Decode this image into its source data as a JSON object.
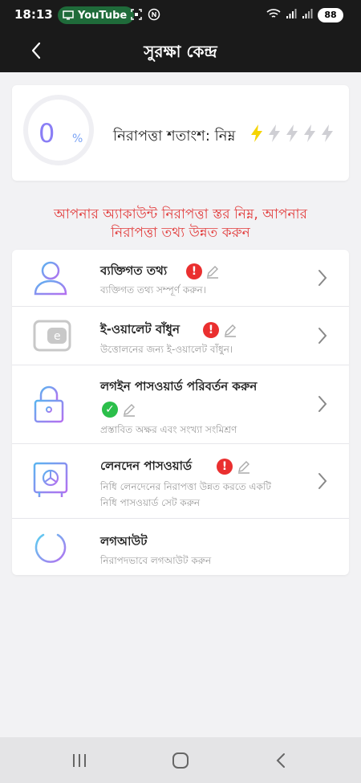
{
  "status_bar": {
    "time": "18:13",
    "app_pill": "YouTube",
    "battery": "88"
  },
  "header": {
    "title": "সুরক্ষা কেন্দ্র"
  },
  "score": {
    "value": "0",
    "unit": "%",
    "label": "নিরাপত্তা শতাংশ: নিম্ন",
    "bolts_total": 5,
    "bolts_active": 1
  },
  "warning": {
    "line1": "আপনার অ্যাকাউন্ট নিরাপত্তা স্তর নিম্ন, আপনার",
    "line2": "নিরাপত্তা তথ্য উন্নত করুন"
  },
  "menu": {
    "items": [
      {
        "title": "ব্যক্তিগত তথ্য",
        "sub1": "ব্যক্তিগত তথ্য সম্পূর্ণ করুন।",
        "sub2": "",
        "status": "warning"
      },
      {
        "title": "ই-ওয়ালেট বাঁধুন",
        "sub1": "উত্তোলনের জন্য ই-ওয়ালেট বাঁধুন।",
        "sub2": "",
        "status": "warning"
      },
      {
        "title": "লগইন পাসওয়ার্ড পরিবর্তন করুন",
        "sub1": "প্রস্তাবিত অক্ষর এবং সংখ্যা সংমিশ্রণ",
        "sub2": "",
        "status": "ok"
      },
      {
        "title": "লেনদেন পাসওয়ার্ড",
        "sub1": "নিধি লেনদেনের নিরাপত্তা উন্নত করতে একটি",
        "sub2": "নিধি পাসওয়ার্ড সেট করুন",
        "status": "warning"
      },
      {
        "title": "লগআউট",
        "sub1": "নিরাপদভাবে লগআউট করুন",
        "sub2": "",
        "status": "none"
      }
    ]
  },
  "colors": {
    "accent_purple": "#8a7ef5",
    "warning_red": "#e23b3b",
    "ok_green": "#2bbf4a",
    "bolt_active": "#f5d400",
    "bolt_inactive": "#cfcfd4"
  }
}
